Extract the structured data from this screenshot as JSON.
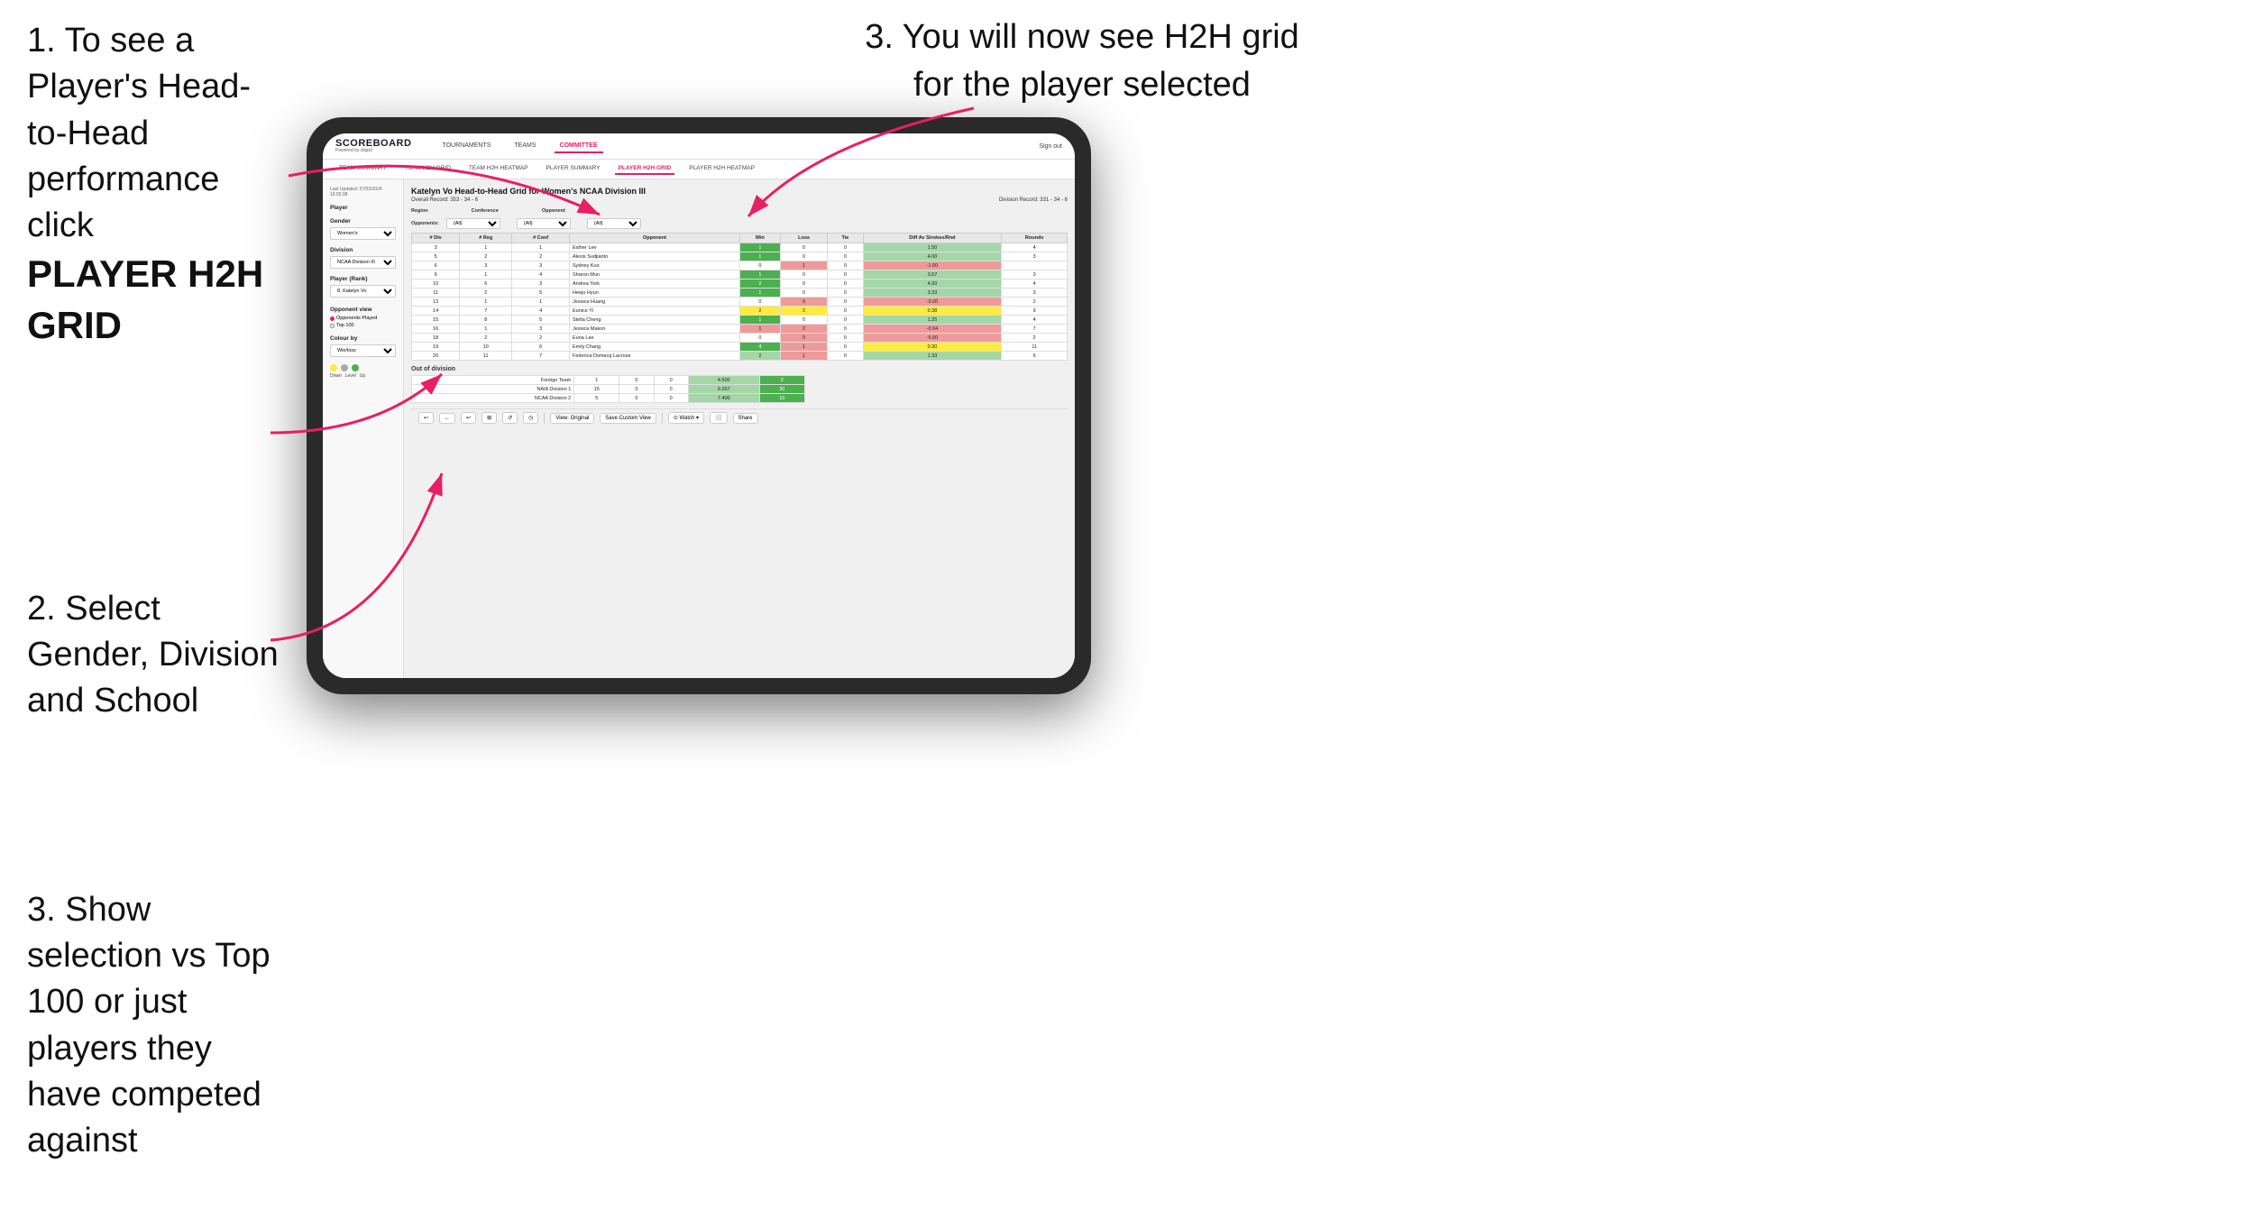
{
  "instructions": {
    "step1_title": "1. To see a Player's Head-to-Head performance click",
    "step1_bold": "PLAYER H2H GRID",
    "step2_title": "2. Select Gender, Division and School",
    "step3_left_title": "3. Show selection vs Top 100 or just players they have competed against",
    "step3_right_title": "3. You will now see H2H grid for the player selected"
  },
  "navbar": {
    "logo": "SCOREBOARD",
    "logo_sub": "Powered by clippd",
    "links": [
      "TOURNAMENTS",
      "TEAMS",
      "COMMITTEE"
    ],
    "active_link": "COMMITTEE",
    "sign_out": "Sign out"
  },
  "sub_navbar": {
    "links": [
      "TEAM SUMMARY",
      "TEAM H2H GRID",
      "TEAM H2H HEATMAP",
      "PLAYER SUMMARY",
      "PLAYER H2H GRID",
      "PLAYER H2H HEATMAP"
    ],
    "active_link": "PLAYER H2H GRID"
  },
  "sidebar": {
    "timestamp_label": "Last Updated: 27/03/2024",
    "timestamp_time": "16:55:38",
    "player_label": "Player",
    "gender_label": "Gender",
    "gender_value": "Women's",
    "division_label": "Division",
    "division_value": "NCAA Division III",
    "player_rank_label": "Player (Rank)",
    "player_rank_value": "8. Katelyn Vo",
    "opponent_view_label": "Opponent view",
    "opponent_option1": "Opponents Played",
    "opponent_option2": "Top 100",
    "colour_label": "Colour by",
    "colour_value": "Win/loss",
    "legend": {
      "down": "Down",
      "level": "Level",
      "up": "Up"
    }
  },
  "panel": {
    "title": "Katelyn Vo Head-to-Head Grid for Women's NCAA Division III",
    "overall_record": "Overall Record: 353 - 34 - 6",
    "division_record": "Division Record: 331 - 34 - 6",
    "region_label": "Region",
    "conference_label": "Conference",
    "opponent_label": "Opponent",
    "opponents_label": "Opponents:",
    "all_option": "(All)",
    "table_headers": [
      "# Div",
      "# Reg",
      "# Conf",
      "Opponent",
      "Win",
      "Loss",
      "Tie",
      "Diff Av Strokes/Rnd",
      "Rounds"
    ],
    "rows": [
      {
        "div": 3,
        "reg": 1,
        "conf": 1,
        "opponent": "Esther Lee",
        "win": 1,
        "loss": 0,
        "tie": 0,
        "diff": 1.5,
        "rounds": 4,
        "win_class": "win-green",
        "loss_class": "",
        "diff_class": "win-light"
      },
      {
        "div": 5,
        "reg": 2,
        "conf": 2,
        "opponent": "Alexis Sudjianto",
        "win": 1,
        "loss": 0,
        "tie": 0,
        "diff": 4.0,
        "rounds": 3,
        "win_class": "win-green",
        "loss_class": "",
        "diff_class": "win-light"
      },
      {
        "div": 6,
        "reg": 3,
        "conf": 3,
        "opponent": "Sydney Kuo",
        "win": 0,
        "loss": 1,
        "tie": 0,
        "diff": -1.0,
        "rounds": "",
        "win_class": "",
        "loss_class": "loss-light",
        "diff_class": "loss-light"
      },
      {
        "div": 9,
        "reg": 1,
        "conf": 4,
        "opponent": "Sharon Mun",
        "win": 1,
        "loss": 0,
        "tie": 0,
        "diff": 3.67,
        "rounds": 3,
        "win_class": "win-green",
        "loss_class": "",
        "diff_class": "win-light"
      },
      {
        "div": 10,
        "reg": 6,
        "conf": 3,
        "opponent": "Andrea York",
        "win": 2,
        "loss": 0,
        "tie": 0,
        "diff": 4.0,
        "rounds": 4,
        "win_class": "win-green",
        "loss_class": "",
        "diff_class": "win-light"
      },
      {
        "div": 11,
        "reg": 2,
        "conf": 5,
        "opponent": "Heejo Hyun",
        "win": 1,
        "loss": 0,
        "tie": 0,
        "diff": 3.33,
        "rounds": 3,
        "win_class": "win-green",
        "loss_class": "",
        "diff_class": "win-light"
      },
      {
        "div": 13,
        "reg": 1,
        "conf": 1,
        "opponent": "Jessica Huang",
        "win": 0,
        "loss": 0,
        "tie": 0,
        "diff": -3.0,
        "rounds": 2,
        "win_class": "",
        "loss_class": "loss-light",
        "diff_class": "loss-light"
      },
      {
        "div": 14,
        "reg": 7,
        "conf": 4,
        "opponent": "Eunice Yi",
        "win": 2,
        "loss": 2,
        "tie": 0,
        "diff": 0.38,
        "rounds": 9,
        "win_class": "yellow-cell",
        "loss_class": "yellow-cell",
        "diff_class": "yellow-cell"
      },
      {
        "div": 15,
        "reg": 8,
        "conf": 5,
        "opponent": "Stella Cheng",
        "win": 1,
        "loss": 0,
        "tie": 0,
        "diff": 1.25,
        "rounds": 4,
        "win_class": "win-green",
        "loss_class": "",
        "diff_class": "win-light"
      },
      {
        "div": 16,
        "reg": 1,
        "conf": 3,
        "opponent": "Jessica Mason",
        "win": 1,
        "loss": 2,
        "tie": 0,
        "diff": -0.94,
        "rounds": 7,
        "win_class": "loss-light",
        "loss_class": "loss-light",
        "diff_class": "loss-light"
      },
      {
        "div": 18,
        "reg": 2,
        "conf": 2,
        "opponent": "Euna Lee",
        "win": 0,
        "loss": 0,
        "tie": 0,
        "diff": -5.0,
        "rounds": 2,
        "win_class": "",
        "loss_class": "loss-light",
        "diff_class": "loss-light"
      },
      {
        "div": 19,
        "reg": 10,
        "conf": 6,
        "opponent": "Emily Chang",
        "win": 4,
        "loss": 1,
        "tie": 0,
        "diff": 0.3,
        "rounds": 11,
        "win_class": "win-green",
        "loss_class": "loss-light",
        "diff_class": "yellow-cell"
      },
      {
        "div": 20,
        "reg": 11,
        "conf": 7,
        "opponent": "Federica Domecq Lacroze",
        "win": 2,
        "loss": 1,
        "tie": 0,
        "diff": 1.33,
        "rounds": 6,
        "win_class": "win-light",
        "loss_class": "loss-light",
        "diff_class": "win-light"
      }
    ],
    "out_of_division_label": "Out of division",
    "out_of_division_rows": [
      {
        "label": "Foreign Team",
        "win": 1,
        "loss": 0,
        "tie": 0,
        "diff": 4.5,
        "rounds": 2
      },
      {
        "label": "NAIA Division 1",
        "win": 15,
        "loss": 0,
        "tie": 0,
        "diff": 9.267,
        "rounds": 30
      },
      {
        "label": "NCAA Division 2",
        "win": 5,
        "loss": 0,
        "tie": 0,
        "diff": 7.4,
        "rounds": 10
      }
    ],
    "toolbar_buttons": [
      "↩",
      "←",
      "↩",
      "⊞",
      "↺",
      "◷",
      "View: Original",
      "Save Custom View",
      "⊙ Watch ▾",
      "⬜",
      "Share"
    ]
  },
  "colors": {
    "accent": "#e91e63",
    "win_green": "#4caf50",
    "win_light": "#a5d6a7",
    "loss_red": "#f44336",
    "loss_light": "#ef9a9a",
    "yellow": "#ffeb3b"
  }
}
